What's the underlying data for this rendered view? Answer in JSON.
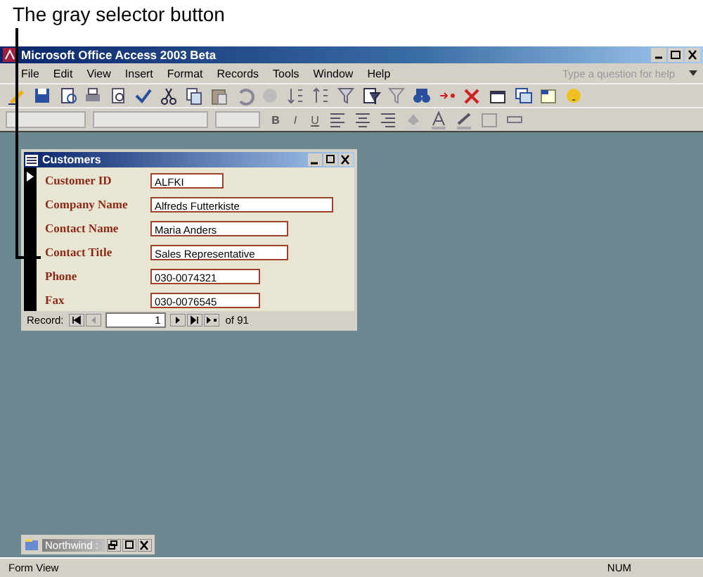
{
  "callout": {
    "text": "The gray selector button"
  },
  "window": {
    "title": "Microsoft Office Access 2003 Beta"
  },
  "menu": [
    "File",
    "Edit",
    "View",
    "Insert",
    "Format",
    "Records",
    "Tools",
    "Window",
    "Help"
  ],
  "help_box": {
    "placeholder": "Type a question for help"
  },
  "format_toolbar": {
    "buttons": [
      "B",
      "I",
      "U"
    ]
  },
  "form": {
    "title": "Customers",
    "fields": [
      {
        "label": "Customer ID",
        "value": "ALFKI"
      },
      {
        "label": "Company Name",
        "value": "Alfreds Futterkiste"
      },
      {
        "label": "Contact Name",
        "value": "Maria Anders"
      },
      {
        "label": "Contact Title",
        "value": "Sales Representative"
      },
      {
        "label": "Phone",
        "value": "030-0074321"
      },
      {
        "label": "Fax",
        "value": "030-0076545"
      }
    ],
    "navigation": {
      "label": "Record:",
      "current": "1",
      "total": "of 91"
    }
  },
  "minimized_window": {
    "title": "Northwind :"
  },
  "status_bar": {
    "mode": "Form View",
    "indicator": "NUM"
  }
}
